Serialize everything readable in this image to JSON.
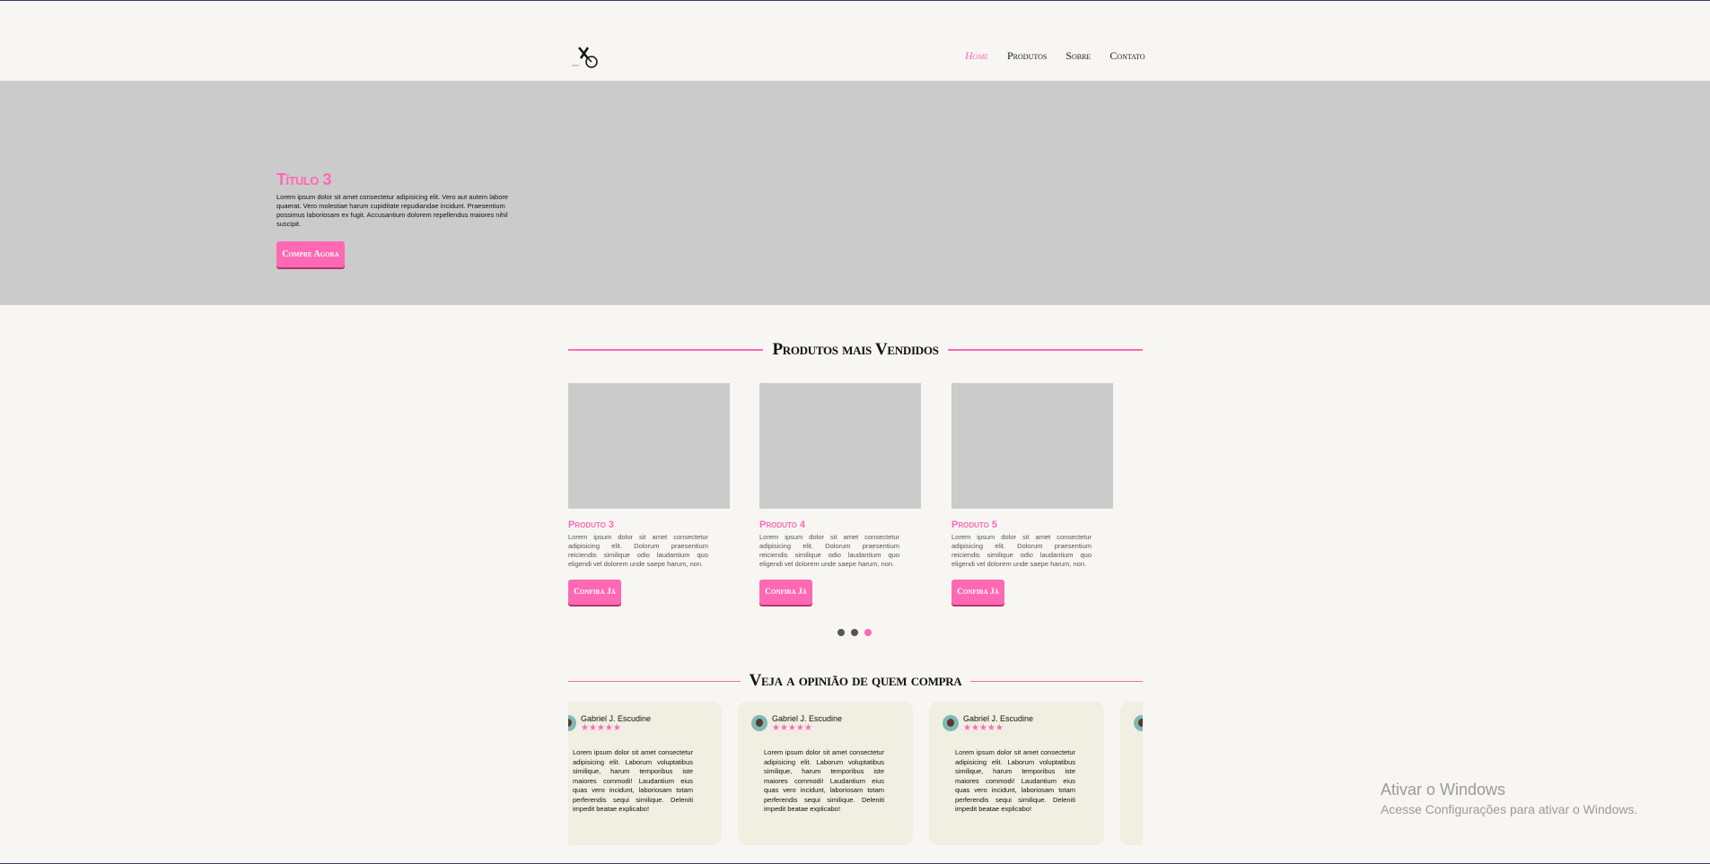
{
  "nav": {
    "items": [
      {
        "label": "Home",
        "active": true
      },
      {
        "label": "Produtos",
        "active": false
      },
      {
        "label": "Sobre",
        "active": false
      },
      {
        "label": "Contato",
        "active": false
      }
    ]
  },
  "hero": {
    "title": "Título 3",
    "text": "Lorem ipsum dolor sit amet consectetur adipisicing elit. Vero aut autem labore quaerat. Vero molestiae harum cupiditate repudiandae incidunt. Praesentium possimus laboriosam ex fugit. Accusantium dolorem repellendus maiores nihil suscipit.",
    "button": "Compre Agora"
  },
  "products_section": {
    "heading": "Produtos mais Vendidos",
    "items": [
      {
        "name": "Produto 3",
        "desc": "Lorem ipsum dolor sit amet consectetur adipisicing elit. Dolorum praesentium reiciendis similique odio laudantium quo eligendi vel dolorem unde saepe harum, non.",
        "button": "Confira Já"
      },
      {
        "name": "Produto 4",
        "desc": "Lorem ipsum dolor sit amet consectetur adipisicing elit. Dolorum praesentium reiciendis similique odio laudantium quo eligendi vel dolorem unde saepe harum, non.",
        "button": "Confira Já"
      },
      {
        "name": "Produto 5",
        "desc": "Lorem ipsum dolor sit amet consectetur adipisicing elit. Dolorum praesentium reiciendis similique odio laudantium quo eligendi vel dolorem unde saepe harum, non.",
        "button": "Confira Já"
      }
    ],
    "carousel": {
      "pages": 3,
      "active_index": 2
    }
  },
  "testimonials_section": {
    "heading": "Veja a opinião de quem compra",
    "items": [
      {
        "name": "Gabriel J. Escudine",
        "stars": "★★★★★",
        "text": "Lorem ipsum dolor sit amet consectetur adipisicing elit. Laborum voluptatibus similique, harum temporibus iste maiores commodi! Laudantium eius quas vero incidunt, laboriosam totam perferendis sequi similique. Deleniti impedit beatae explicabo!"
      },
      {
        "name": "Gabriel J. Escudine",
        "stars": "★★★★★",
        "text": "Lorem ipsum dolor sit amet consectetur adipisicing elit. Laborum voluptatibus similique, harum temporibus iste maiores commodi! Laudantium eius quas vero incidunt, laboriosam totam perferendis sequi similique. Deleniti impedit beatae explicabo!"
      },
      {
        "name": "Gabriel J. Escudine",
        "stars": "★★★★★",
        "text": "Lorem ipsum dolor sit amet consectetur adipisicing elit. Laborum voluptatibus similique, harum temporibus iste maiores commodi! Laudantium eius quas vero incidunt, laboriosam totam perferendis sequi similique. Deleniti impedit beatae explicabo!"
      }
    ]
  },
  "watermark": {
    "title": "Ativar o Windows",
    "subtitle": "Acesse Configurações para ativar o Windows."
  },
  "colors": {
    "accent": "#ff69b4",
    "hero_bg": "#cbcbcb",
    "page_bg": "#f7f6f2",
    "card_bg": "#f0efe2"
  }
}
